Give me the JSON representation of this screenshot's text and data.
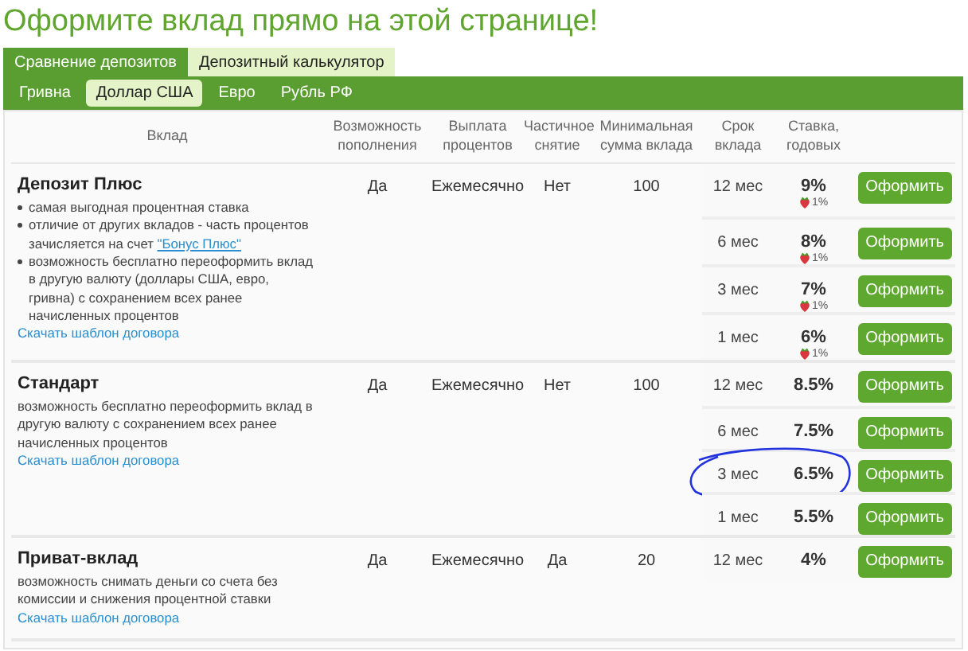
{
  "title": "Оформите вклад прямо на этой странице!",
  "tabs": [
    {
      "label": "Сравнение депозитов",
      "selected": true
    },
    {
      "label": "Депозитный калькулятор",
      "selected": false
    }
  ],
  "currencies": [
    {
      "label": "Гривна",
      "selected": false
    },
    {
      "label": "Доллар США",
      "selected": true
    },
    {
      "label": "Евро",
      "selected": false
    },
    {
      "label": "Рубль РФ",
      "selected": false
    }
  ],
  "columns": [
    "Вклад",
    "Возможность пополнения",
    "Выплата процентов",
    "Частичное снятие",
    "Минимальная сумма вклада",
    "Срок вклада",
    "Ставка, годовых"
  ],
  "deposits": [
    {
      "name": "Депозит Плюс",
      "bullets": [
        {
          "text": "самая выгодная процентная ставка"
        },
        {
          "text": "отличие от других вкладов - часть процентов зачисляется на счет",
          "link": "\"Бонус Плюс\""
        },
        {
          "text": "возможность бесплатно переоформить вклад в другую валюту (доллары США, евро, гривна) с сохранением всех ранее начисленных процентов"
        }
      ],
      "download": "Скачать шаблон договора",
      "refill": "Да",
      "payout": "Ежемесячно",
      "withdrawal": "Нет",
      "min_sum": "100",
      "terms": [
        {
          "term": "12 мес",
          "rate": "9%",
          "bonus": "1%",
          "button": "Оформить",
          "circled": false
        },
        {
          "term": "6 мес",
          "rate": "8%",
          "bonus": "1%",
          "button": "Оформить",
          "circled": false
        },
        {
          "term": "3 мес",
          "rate": "7%",
          "bonus": "1%",
          "button": "Оформить",
          "circled": false
        },
        {
          "term": "1 мес",
          "rate": "6%",
          "bonus": "1%",
          "button": "Оформить",
          "circled": false
        }
      ]
    },
    {
      "name": "Стандарт",
      "description": "возможность бесплатно переоформить вклад в другую валюту с сохранением всех ранее начисленных процентов",
      "download": "Скачать шаблон договора",
      "refill": "Да",
      "payout": "Ежемесячно",
      "withdrawal": "Нет",
      "min_sum": "100",
      "terms": [
        {
          "term": "12 мес",
          "rate": "8.5%",
          "button": "Оформить",
          "circled": false
        },
        {
          "term": "6 мес",
          "rate": "7.5%",
          "button": "Оформить",
          "circled": false
        },
        {
          "term": "3 мес",
          "rate": "6.5%",
          "button": "Оформить",
          "circled": true
        },
        {
          "term": "1 мес",
          "rate": "5.5%",
          "button": "Оформить",
          "circled": false
        }
      ]
    },
    {
      "name": "Приват-вклад",
      "description": "возможность снимать деньги со счета без комиссии и снижения процентной ставки",
      "download": "Скачать шаблон договора",
      "refill": "Да",
      "payout": "Ежемесячно",
      "withdrawal": "Да",
      "min_sum": "20",
      "terms": [
        {
          "term": "12 мес",
          "rate": "4%",
          "button": "Оформить",
          "circled": false
        }
      ]
    }
  ]
}
